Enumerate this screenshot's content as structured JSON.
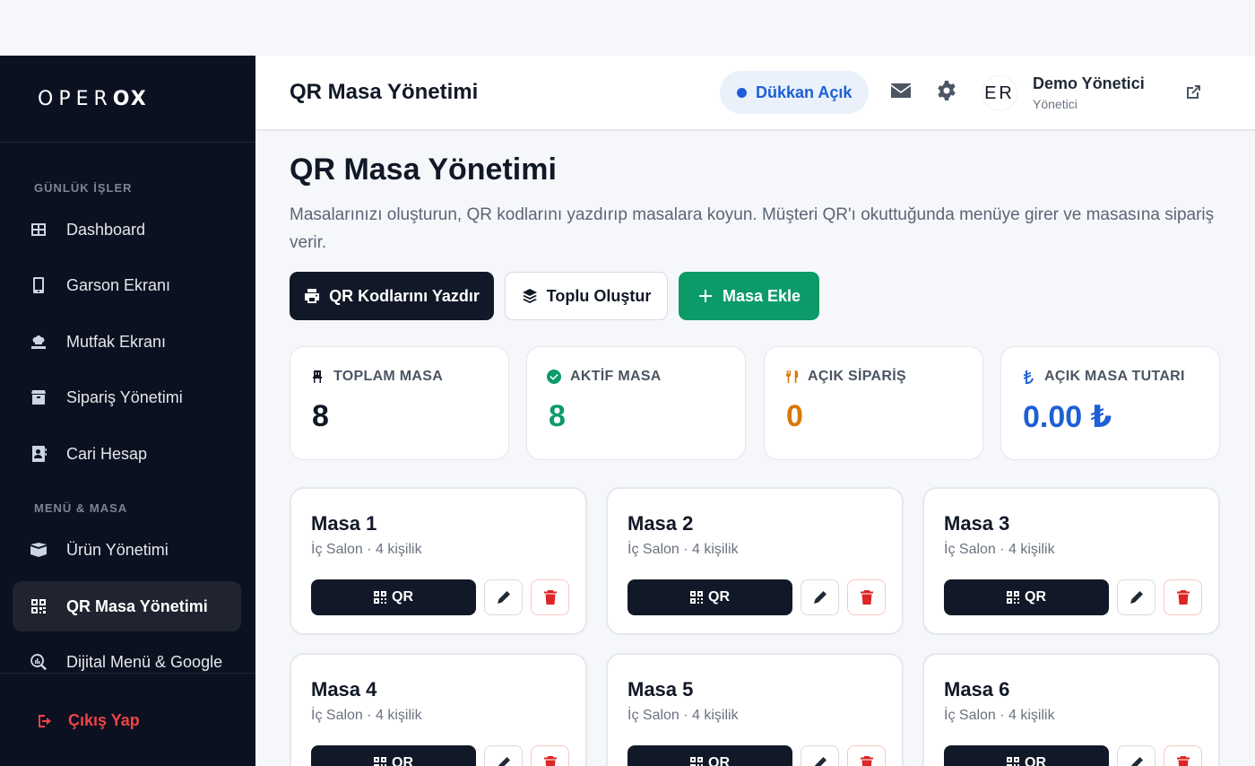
{
  "brand": {
    "logo_left": "OPER",
    "logo_right": "OX"
  },
  "sidebar": {
    "sections": [
      {
        "title": "GÜNLÜK İŞLER"
      },
      {
        "title": "MENÜ & MASA"
      }
    ],
    "items": [
      {
        "label": "Dashboard",
        "icon": "grid-icon"
      },
      {
        "label": "Garson Ekranı",
        "icon": "mobile-icon"
      },
      {
        "label": "Mutfak Ekranı",
        "icon": "chef-icon"
      },
      {
        "label": "Sipariş Yönetimi",
        "icon": "box-icon"
      },
      {
        "label": "Cari Hesap",
        "icon": "contact-book-icon"
      },
      {
        "label": "Ürün Yönetimi",
        "icon": "boxes-icon"
      },
      {
        "label": "QR Masa Yönetimi",
        "icon": "qrcode-icon",
        "active": true
      },
      {
        "label": "Dijital Menü & Google",
        "icon": "search-chart-icon"
      }
    ],
    "logout_label": "Çıkış Yap"
  },
  "header": {
    "title": "QR Masa Yönetimi",
    "shop_status": "Dükkan Açık",
    "user": {
      "initials": "ER",
      "name": "Demo Yönetici",
      "role": "Yönetici"
    }
  },
  "page": {
    "title": "QR Masa Yönetimi",
    "description": "Masalarınızı oluşturun, QR kodlarını yazdırıp masalara koyun. Müşteri QR'ı okuttuğunda menüye girer ve masasına sipariş verir.",
    "buttons": {
      "print": "QR Kodlarını Yazdır",
      "bulk": "Toplu Oluştur",
      "add": "Masa Ekle"
    }
  },
  "stats": [
    {
      "label": "TOPLAM MASA",
      "value": "8",
      "color": "#111827",
      "icon": "chair-icon"
    },
    {
      "label": "AKTİF MASA",
      "value": "8",
      "color": "#0c9b68",
      "icon": "check-circle-icon"
    },
    {
      "label": "AÇIK SİPARİŞ",
      "value": "0",
      "color": "#d97706",
      "icon": "utensils-icon"
    },
    {
      "label": "AÇIK MASA TUTARI",
      "value": "0.00 ₺",
      "color": "#1d5fd6",
      "icon": "lira-icon"
    }
  ],
  "tables": [
    {
      "name": "Masa 1",
      "info": "İç Salon · 4 kişilik",
      "qr_label": "QR"
    },
    {
      "name": "Masa 2",
      "info": "İç Salon · 4 kişilik",
      "qr_label": "QR"
    },
    {
      "name": "Masa 3",
      "info": "İç Salon · 4 kişilik",
      "qr_label": "QR"
    },
    {
      "name": "Masa 4",
      "info": "İç Salon · 4 kişilik",
      "qr_label": "QR"
    },
    {
      "name": "Masa 5",
      "info": "İç Salon · 4 kişilik",
      "qr_label": "QR"
    },
    {
      "name": "Masa 6",
      "info": "İç Salon · 4 kişilik",
      "qr_label": "QR"
    }
  ]
}
